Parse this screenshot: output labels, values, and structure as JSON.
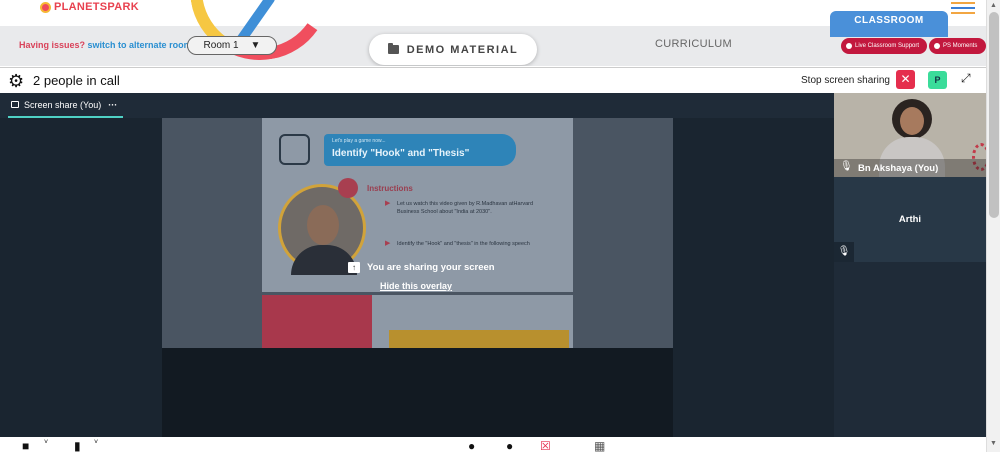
{
  "header": {
    "logo_text": "PLANETSPARK",
    "issues_text": "Having issues?",
    "alt_room_link": "switch to alternate room",
    "room_select": "Room 1",
    "demo_material": "DEMO MATERIAL",
    "curriculum": "CURRICULUM",
    "classroom_tab": "CLASSROOM",
    "live_support": "Live Classroom Support",
    "ps_moments": "PS Moments"
  },
  "callbar": {
    "people_count": "2 people in call",
    "stop_sharing": "Stop screen sharing",
    "participant_badge": "P"
  },
  "share": {
    "tab_label": "Screen share (You)",
    "sharing_message": "You are sharing your screen",
    "hide_overlay": "Hide this overlay"
  },
  "slide": {
    "small_text": "Let's play a game now...",
    "title": "Identify \"Hook\" and \"Thesis\"",
    "heading": "Instructions",
    "bullet1": "Let us watch this video given by R.Madhavan atHarvard Business School about \"India at 2030\".",
    "bullet2": "Identify the \"Hook\" and \"thesis\" in the following speech"
  },
  "participants": [
    {
      "name": "Bn Akshaya (You)"
    },
    {
      "name": "Arthi"
    }
  ],
  "colors": {
    "brand_red": "#c2183e",
    "classroom_blue": "#4a90d9",
    "stop_red": "#e52e4d",
    "badge_green": "#3bdc9a",
    "tab_underline": "#4fd1c5"
  }
}
